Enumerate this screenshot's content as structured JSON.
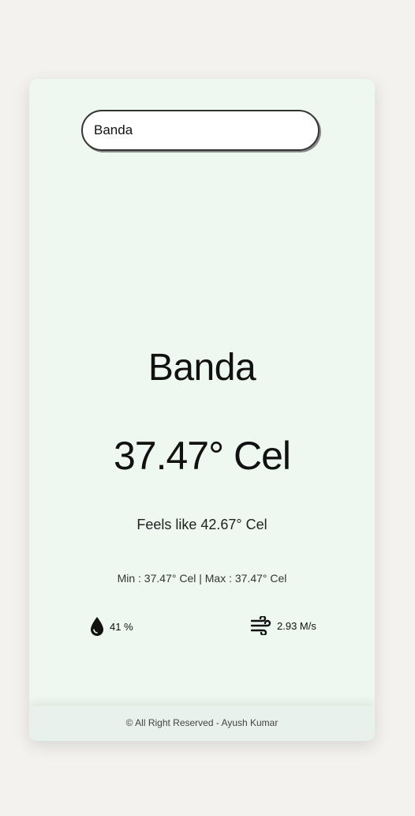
{
  "search": {
    "value": "Banda",
    "placeholder": ""
  },
  "weather": {
    "city": "Banda",
    "temperature": "37.47° Cel",
    "feels_like": "Feels like 42.67° Cel",
    "min_max": "Min : 37.47° Cel | Max : 37.47° Cel",
    "humidity": "41 %",
    "wind": "2.93 M/s"
  },
  "icons": {
    "humidity": "water-drop-icon",
    "wind": "wind-icon"
  },
  "footer": {
    "text": "© All Right Reserved - Ayush Kumar"
  },
  "colors": {
    "page_background": "#f3f2ef",
    "card_background": "#eef8f1"
  }
}
